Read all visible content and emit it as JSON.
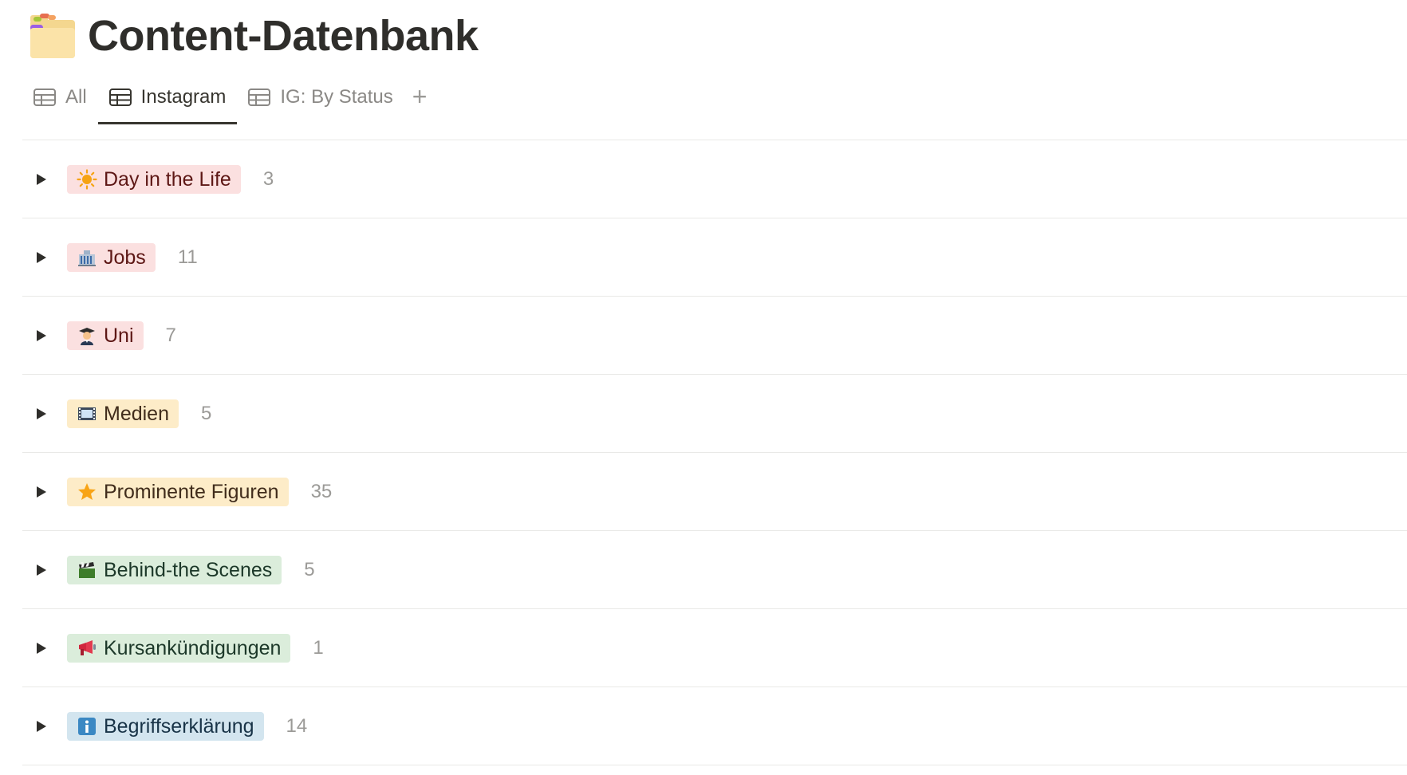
{
  "page": {
    "title": "Content-Datenbank",
    "icon": "folder-icon"
  },
  "tabs": [
    {
      "label": "All",
      "icon": "table-icon",
      "active": false
    },
    {
      "label": "Instagram",
      "icon": "table-icon",
      "active": true
    },
    {
      "label": "IG: By Status",
      "icon": "table-icon",
      "active": false
    }
  ],
  "add_view_label": "+",
  "groups": [
    {
      "label": "Day in the Life",
      "count": "3",
      "color": "red",
      "icon": "sun-icon"
    },
    {
      "label": "Jobs",
      "count": "11",
      "color": "red",
      "icon": "office-building-icon"
    },
    {
      "label": "Uni",
      "count": "7",
      "color": "red",
      "icon": "student-icon"
    },
    {
      "label": "Medien",
      "count": "5",
      "color": "yellow",
      "icon": "film-strip-icon"
    },
    {
      "label": "Prominente Figuren",
      "count": "35",
      "color": "yellow",
      "icon": "star-icon"
    },
    {
      "label": "Behind-the Scenes",
      "count": "5",
      "color": "green",
      "icon": "clapper-board-icon"
    },
    {
      "label": "Kursankündigungen",
      "count": "1",
      "color": "green",
      "icon": "megaphone-icon"
    },
    {
      "label": "Begriffserklärung",
      "count": "14",
      "color": "blue",
      "icon": "information-icon"
    }
  ],
  "colors": {
    "red_tag_bg": "#fbe0e0",
    "yellow_tag_bg": "#fdecc8",
    "green_tag_bg": "#dbeddb",
    "blue_tag_bg": "#d3e5ef"
  }
}
